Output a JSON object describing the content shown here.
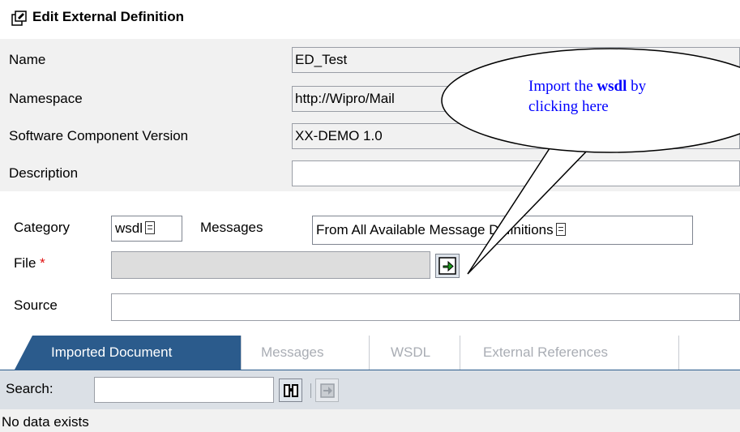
{
  "header": {
    "title": "Edit External Definition",
    "icon": "edit-definition-icon"
  },
  "form": {
    "name_label": "Name",
    "name_value": "ED_Test",
    "namespace_label": "Namespace",
    "namespace_value": "http://Wipro/Mail",
    "swcv_label": "Software Component Version",
    "swcv_value": "XX-DEMO 1.0",
    "description_label": "Description",
    "description_value": ""
  },
  "settings": {
    "category_label": "Category",
    "category_value": "wsdl",
    "messages_label": "Messages",
    "messages_value": "From All Available Message Definitions",
    "file_label": "File",
    "file_required": "*",
    "file_value": "",
    "source_label": "Source",
    "source_value": ""
  },
  "callout": {
    "text_before": "Import the ",
    "text_bold": "wsdl",
    "text_after": " by",
    "line2": "clicking here",
    "color": "#0000ff"
  },
  "tabs": [
    {
      "label": "Imported Document",
      "active": true
    },
    {
      "label": "Messages",
      "active": false
    },
    {
      "label": "WSDL",
      "active": false
    },
    {
      "label": "External References",
      "active": false
    }
  ],
  "search": {
    "label": "Search:",
    "value": ""
  },
  "status": {
    "empty_message": "No data exists"
  },
  "colors": {
    "tab_active": "#2b5b8c",
    "required": "#e01010",
    "callout_text": "#0000ff"
  }
}
